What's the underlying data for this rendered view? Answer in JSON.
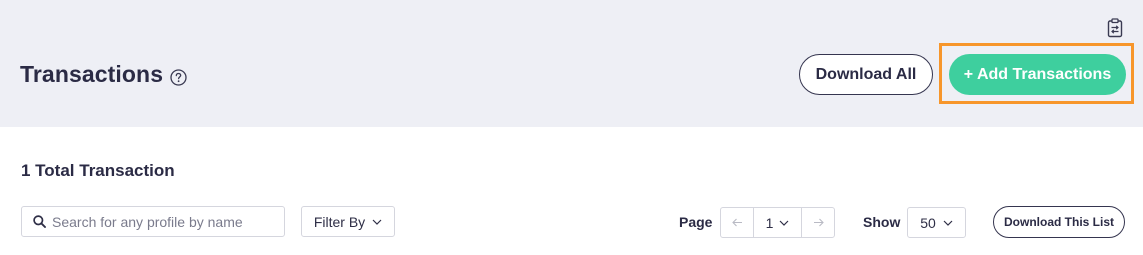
{
  "header": {
    "title": "Transactions",
    "download_all_label": "Download All",
    "add_label": "+ Add Transactions",
    "add_color": "#3ecf9e",
    "highlight_color": "#f7962b",
    "background": "#eeeff5",
    "icons": [
      "clipboard-swap-icon",
      "help-circle-icon"
    ]
  },
  "summary": {
    "total_text": "1 Total Transaction"
  },
  "toolbar": {
    "search_placeholder": "Search for any profile by name",
    "search_value": "",
    "filter_label": "Filter By",
    "page_label": "Page",
    "page_current": "1",
    "show_label": "Show",
    "show_value": "50",
    "download_list_label": "Download This List"
  }
}
